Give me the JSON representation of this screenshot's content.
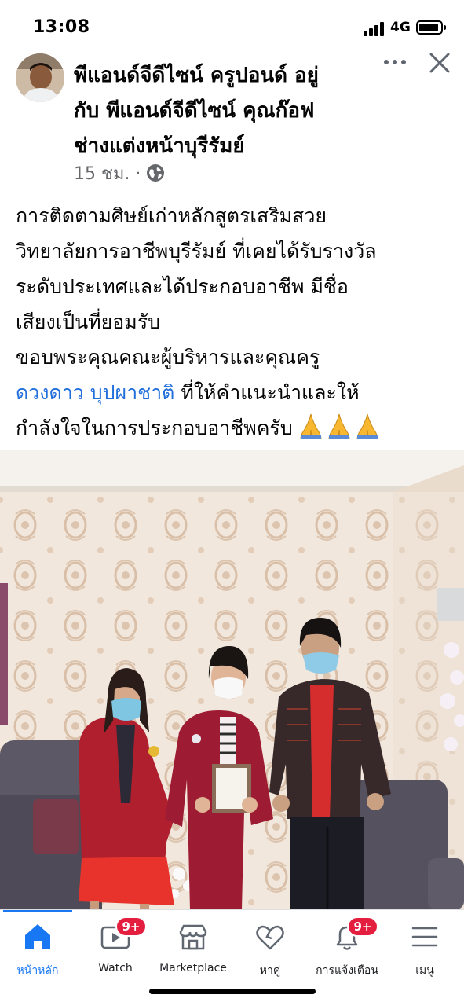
{
  "status_bar": {
    "time": "13:08",
    "network": "4G"
  },
  "post": {
    "author_line1": "พีแอนด์จีดีไซน์ ครูปอนด์ อยู่",
    "author_line2": "กับ พีแอนด์จีดีไซน์ คุณก๊อฟ",
    "author_line3": "ช่างแต่งหน้าบุรีรัมย์",
    "time": "15 ชม. ·",
    "privacy_icon": "globe-icon",
    "text_lines": [
      "การติดตามศิษย์เก่าหลักสูตรเสริมสวย",
      "วิทยาลัยการอาชีพบุรีรัมย์ ที่เคยได้รับรางวัล",
      "ระดับประเทศและได้ประกอบอาชีพ มีชื่อ",
      "เสียงเป็นที่ยอมรับ",
      "ขอบพระคุณคณะผู้บริหารและคุณครู"
    ],
    "mention": "ดวงดาว บุปผาชาติ",
    "after_mention": " ที่ให้คำแนะนำและให้",
    "last_line": "กำลังใจในการประกอบอาชีพครับ",
    "emoji": "folded-hands x3"
  },
  "tab_bar": {
    "tabs": [
      {
        "label": "หน้าหลัก",
        "icon": "home-icon",
        "active": true
      },
      {
        "label": "Watch",
        "icon": "watch-icon",
        "badge": "9+"
      },
      {
        "label": "Marketplace",
        "icon": "marketplace-icon"
      },
      {
        "label": "หาคู่",
        "icon": "dating-heart-icon"
      },
      {
        "label": "การแจ้งเตือน",
        "icon": "bell-icon",
        "badge": "9+"
      },
      {
        "label": "เมนู",
        "icon": "menu-icon"
      }
    ]
  },
  "colors": {
    "accent": "#1877f2",
    "mention": "#216fdb",
    "badge": "#e41e3f",
    "meta": "#65676b"
  }
}
